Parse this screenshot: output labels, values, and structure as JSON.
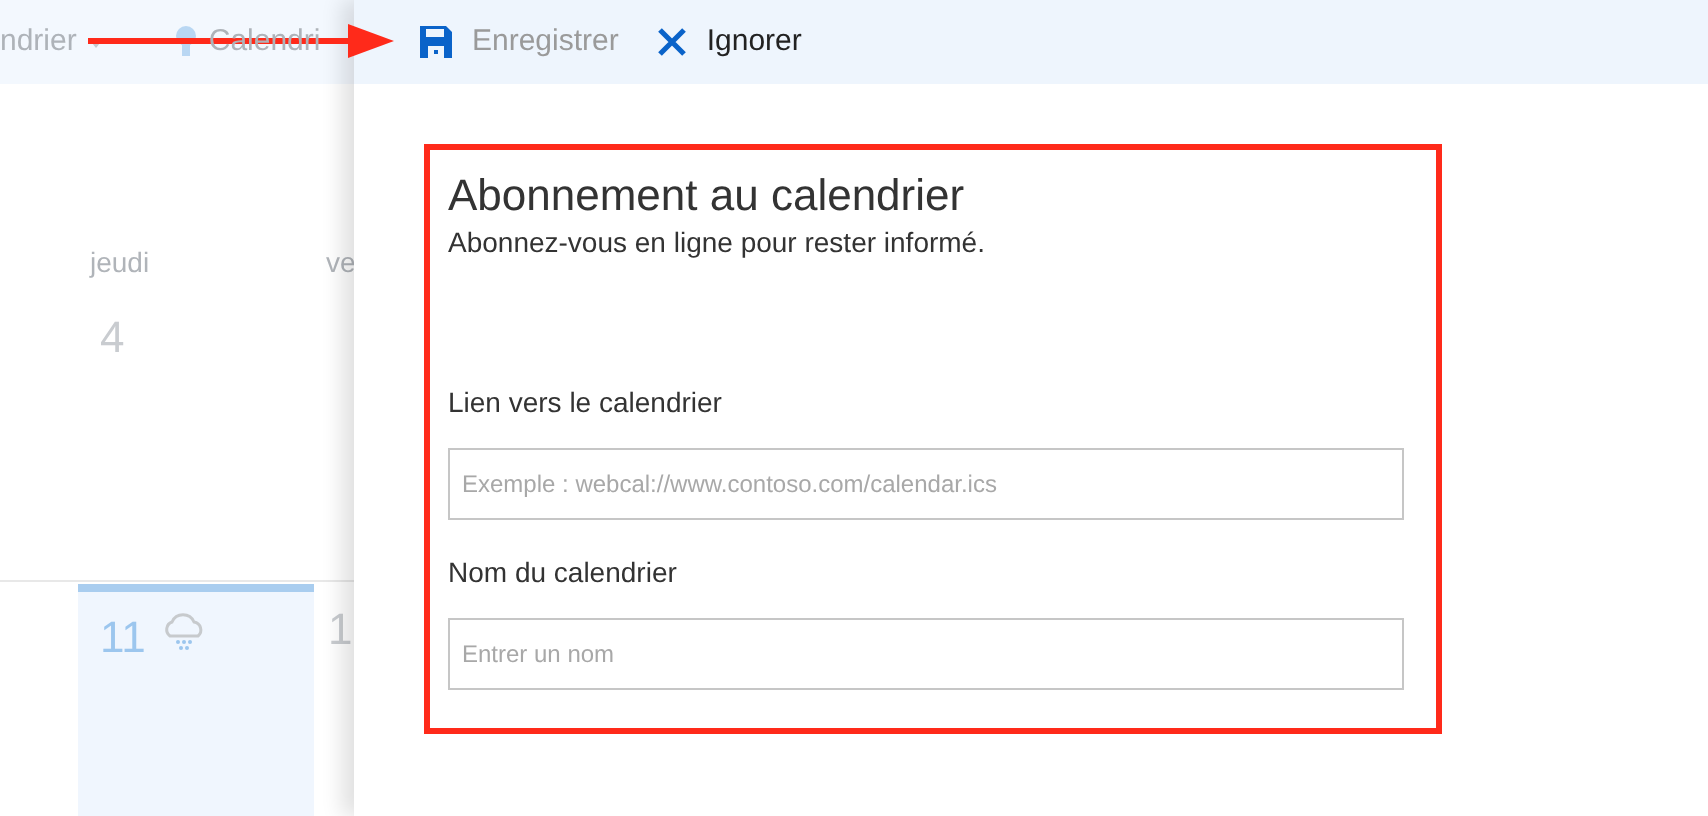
{
  "background": {
    "toolbar": [
      {
        "label": "ndrier",
        "kind": "dropdown"
      },
      {
        "label": "Calendri",
        "kind": "bulb"
      }
    ],
    "day_headers": [
      "jeudi",
      "ve"
    ],
    "days": [
      {
        "label": "4",
        "today": false
      },
      {
        "label": "11",
        "today": true
      },
      {
        "label": "1",
        "today": false
      }
    ]
  },
  "panel": {
    "toolbar": [
      {
        "label": "Enregistrer",
        "kind": "save",
        "disabled": true
      },
      {
        "label": "Ignorer",
        "kind": "discard",
        "disabled": false
      }
    ],
    "title": "Abonnement au calendrier",
    "subtitle": "Abonnez-vous en ligne pour rester informé.",
    "fields": [
      {
        "label": "Lien vers le calendrier",
        "placeholder": "Exemple : webcal://www.contoso.com/calendar.ics"
      },
      {
        "label": "Nom du calendrier",
        "placeholder": "Entrer un nom"
      }
    ]
  }
}
